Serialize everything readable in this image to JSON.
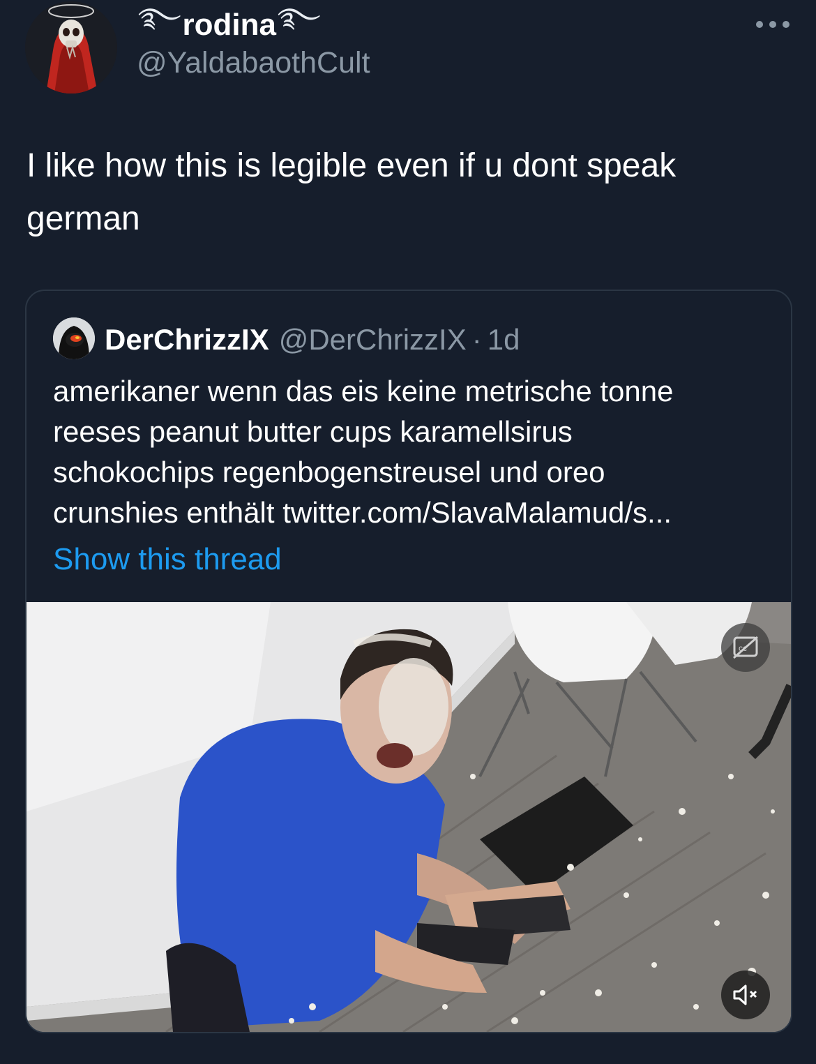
{
  "tweet": {
    "author": {
      "display_name": "rodina",
      "name_decoration": "࿐",
      "handle": "@YaldabaothCult",
      "avatar_icon": "skull-hooded-figure-avatar"
    },
    "text_line_1": "I like how this is legible even if u dont speak",
    "text_line_2": "german",
    "more_icon": "more-dots-icon"
  },
  "quoted_tweet": {
    "author": {
      "display_name": "DerChrizzIX",
      "handle": "@DerChrizzIX",
      "separator": "·",
      "time": "1d"
    },
    "text_lines": [
      "amerikaner wenn das eis keine metrische tonne",
      "reeses peanut butter cups karamellsirus",
      "schokochips regenbogenstreusel und oreo",
      "crunshies enthält twitter.com/SlavaMalamud/s..."
    ],
    "show_thread_label": "Show this thread",
    "media": {
      "type": "video",
      "cc_icon": "closed-captions-off-icon",
      "mute_icon": "speaker-muted-icon"
    }
  },
  "colors": {
    "background": "#161e2c",
    "text_primary": "#ffffff",
    "text_secondary": "#8b98a5",
    "link": "#1d9bf0",
    "card_border": "#2b3644"
  }
}
